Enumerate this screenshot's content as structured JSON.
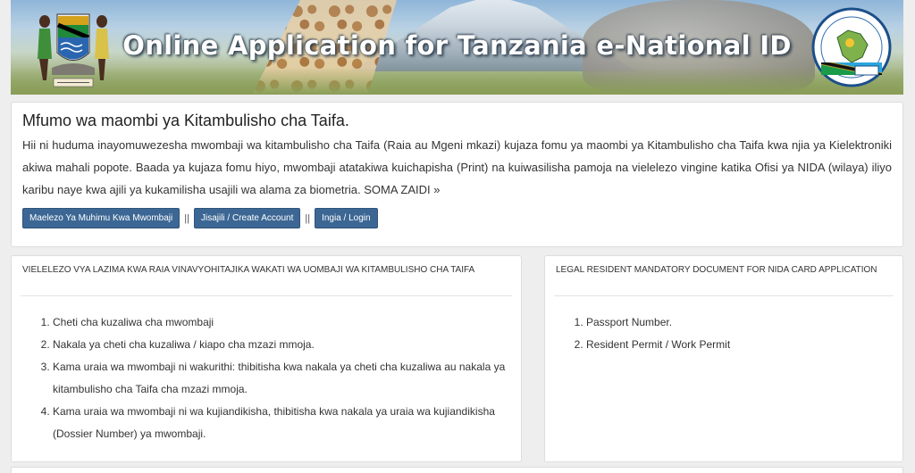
{
  "banner": {
    "title": "Online Application for Tanzania e-National ID",
    "left_logo": "coat-of-arms-icon",
    "right_logo": "nida-logo-icon"
  },
  "intro": {
    "heading": "Mfumo wa maombi ya Kitambulisho cha Taifa.",
    "body": "Hii ni huduma inayomuwezesha mwombaji wa kitambulisho cha Taifa (Raia au Mgeni mkazi) kujaza fomu ya maombi ya Kitambulisho cha Taifa kwa njia ya Kielektroniki akiwa mahali popote. Baada ya kujaza fomu hiyo, mwombaji atatakiwa kuichapisha (Print) na kuiwasilisha pamoja na vielelezo vingine katika Ofisi ya NIDA (wilaya) iliyo karibu naye kwa ajili ya kukamilisha usajili wa alama za biometria. SOMA ZAIDI »",
    "buttons": {
      "info": "Maelezo Ya Muhimu Kwa Mwombaji",
      "register": "Jisajili / Create Account",
      "login": "Ingia / Login",
      "separator": "||"
    }
  },
  "citizen_panel": {
    "title": "VIELELEZO VYA LAZIMA KWA RAIA VINAVYOHITAJIKA WAKATI WA UOMBAJI WA KITAMBULISHO CHA TAIFA",
    "items": [
      "Cheti cha kuzaliwa cha mwombaji",
      "Nakala ya cheti cha kuzaliwa / kiapo cha mzazi mmoja.",
      "Kama uraia wa mwombaji ni wakurithi: thibitisha kwa nakala ya cheti cha kuzaliwa au nakala ya kitambulisho cha Taifa cha mzazi mmoja.",
      "Kama uraia wa mwombaji ni wa kujiandikisha, thibitisha kwa nakala ya uraia wa kujiandikisha (Dossier Number) ya mwombaji."
    ]
  },
  "resident_panel": {
    "title": "LEGAL RESIDENT MANDATORY DOCUMENT FOR NIDA CARD APPLICATION",
    "items": [
      "Passport Number.",
      "Resident Permit / Work Permit"
    ]
  },
  "colors": {
    "button": "#3c6794",
    "panel_border": "#dddddd",
    "background": "#eeeeee"
  }
}
